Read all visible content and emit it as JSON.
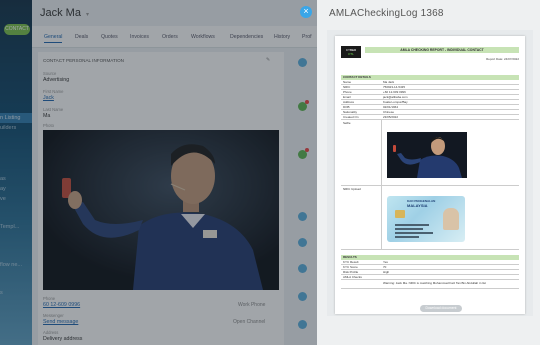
{
  "sidebar": {
    "button_label": "CONTACT",
    "items": [
      "n Listing",
      "uilders",
      "as",
      "ay",
      "ve",
      "Templ...",
      "flow ne...",
      "s"
    ]
  },
  "contact": {
    "name": "Jack Ma",
    "tabs": [
      "General",
      "Deals",
      "Quotes",
      "Invoices",
      "Orders",
      "Workflows",
      "Dependencies",
      "History",
      "Prof"
    ],
    "active_tab": "General",
    "section_header": "CONTACT PERSONAL INFORMATION",
    "fields": {
      "source_label": "Source",
      "source_value": "Advertising",
      "first_name_label": "First Name",
      "first_name_value": "Jack",
      "last_name_label": "Last Name",
      "last_name_value": "Ma",
      "photo_label": "Photo",
      "phone_label": "Phone",
      "phone_value": "60 12-609 0996",
      "phone_type": "Work Phone",
      "messenger_label": "Messenger",
      "messenger_value": "Send message",
      "messenger_type": "Open Channel",
      "address_label": "Address",
      "address_value": "Delivery address"
    }
  },
  "panel": {
    "title": "AMLACheckingLog 1368",
    "download_label": "Download document"
  },
  "document": {
    "logo_top": "CYBER",
    "logo_bottom": "CTL",
    "report_title": "AMLA CHECKING REPORT - INDIVIDUAL CONTACT",
    "report_date": "Report Date: 24/07/2022",
    "contact_section": "CONTACT DETAILS",
    "rows": [
      {
        "k": "Name",
        "v": "Ma Jack"
      },
      {
        "k": "NRIC",
        "v": "750923-14-5435"
      },
      {
        "k": "Phone",
        "v": "+60 12-609 0996"
      },
      {
        "k": "Email",
        "v": "jack@alibaba.com"
      },
      {
        "k": "Address",
        "v": "Kuala Lumpur/Bay"
      },
      {
        "k": "DOB",
        "v": "02/01/1964"
      },
      {
        "k": "Nationality",
        "v": "Chinese"
      },
      {
        "k": "Created On",
        "v": "23/05/2022"
      }
    ],
    "selfie_label": "Selfie",
    "nric_upload_label": "NRIC Upload",
    "id_card_header": "KAD PENGENALAN",
    "id_card_country": "MALAYSIA",
    "results_section": "RESULTS",
    "result_rows": [
      {
        "k": "KYC Result",
        "v": "Yes"
      },
      {
        "k": "KYC Score",
        "v": "70"
      },
      {
        "k": "Risk Profile",
        "v": "High"
      },
      {
        "k": "AMLA Checks",
        "v": ""
      }
    ],
    "amla_note": "Warning: Jack Ma. NRIC is matching Muhammad Faiz Tan Bin Abdullah in list"
  },
  "colors": {
    "accent": "#2067b0",
    "sidebar_button": "#7bc24a",
    "close_button": "#3aa6e8",
    "doc_band": "#c7e3b5"
  }
}
